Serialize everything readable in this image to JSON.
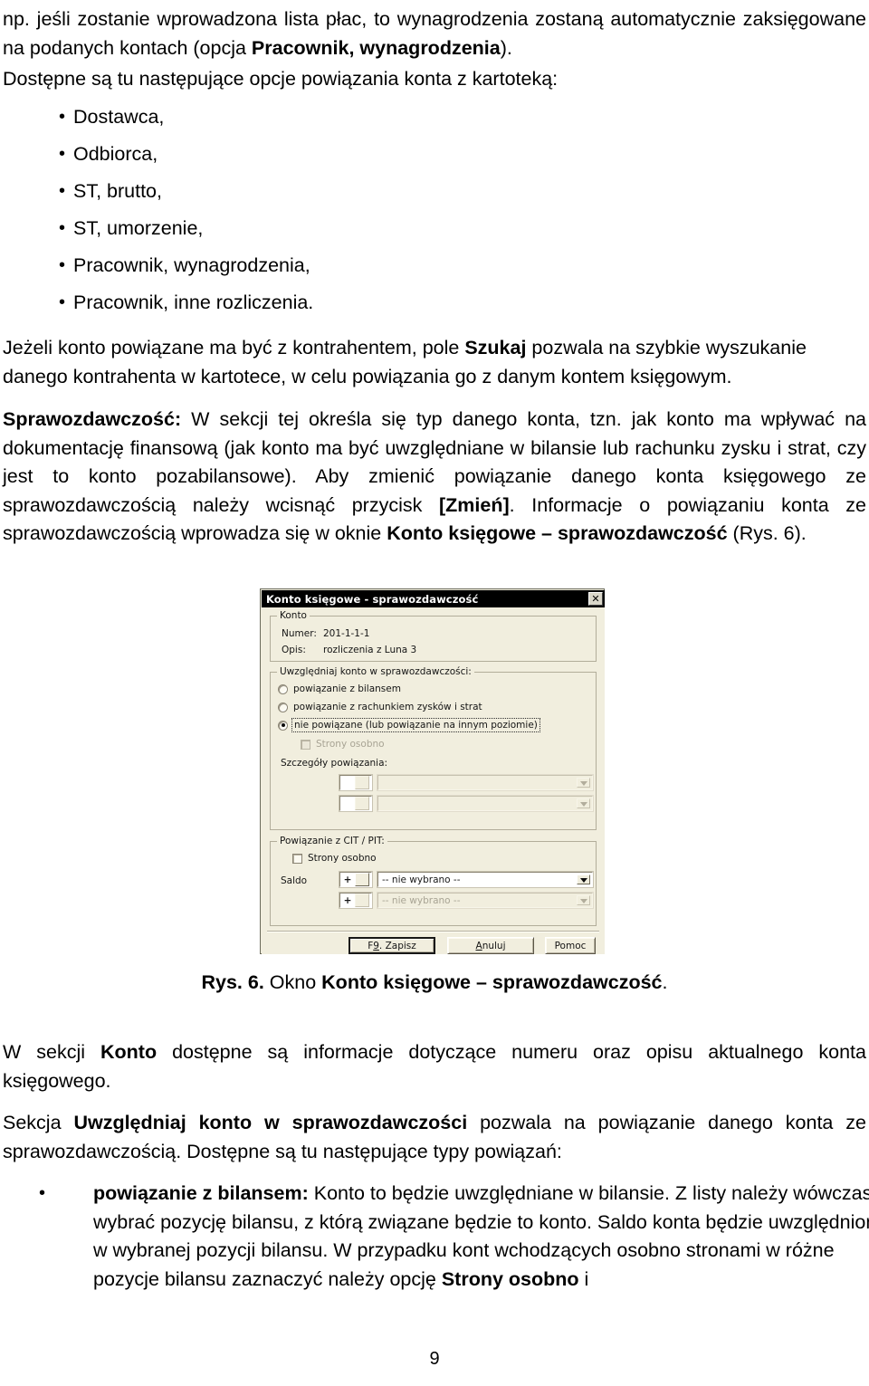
{
  "document": {
    "page_number": "9",
    "paragraphs": {
      "intro": {
        "line1_plain_a": "np. jeśli zostanie wprowadzona lista płac, to wynagrodzenia zostaną automatycznie zaksięgowane na podanych kontach (opcja ",
        "line1_bold": "Pracownik, wynagrodzenia",
        "line1_plain_b": ")."
      },
      "available_options_lead": "Dostępne są tu następujące opcje powiązania konta z kartoteką:",
      "search_info_a": "Jeżeli konto powiązane ma być z kontrahentem, pole ",
      "search_info_bold": "Szukaj",
      "search_info_b": " pozwala na szybkie wyszukanie danego kontrahenta w kartotece, w celu powiązania go z danym kontem księgowym.",
      "reporting_bold": "Sprawozdawczość:",
      "reporting_a": " W sekcji tej określa się typ danego konta, tzn. jak konto ma wpływać na dokumentację finansową (jak konto ma być uwzględniane w bilansie lub rachunku zysku i strat, czy jest to konto pozabilansowe). Aby zmienić powiązanie danego konta księgowego ze sprawozdawczością należy wcisnąć przycisk ",
      "reporting_bold2": "[Zmień]",
      "reporting_b": ". Informacje o powiązaniu konta ze sprawozdawczością wprowadza się w oknie ",
      "reporting_bold3": "Konto księgowe – sprawozdawczość",
      "reporting_c": " (Rys. 6).",
      "konto_section_a": "W sekcji ",
      "konto_section_bold": "Konto",
      "konto_section_b": " dostępne są informacje dotyczące numeru oraz opisu aktualnego konta księgowego.",
      "uwzgledniaj_a": "Sekcja ",
      "uwzgledniaj_bold": "Uwzględniaj konto w sprawozdawczości",
      "uwzgledniaj_b": " pozwala na powiązanie danego konta ze sprawozdawczością. Dostępne są tu następujące typy powiązań:"
    },
    "bullet_list": [
      "Dostawca,",
      "Odbiorca,",
      "ST, brutto,",
      "ST, umorzenie,",
      "Pracownik, wynagrodzenia,",
      "Pracownik, inne rozliczenia."
    ],
    "last_bullet": {
      "bold_lead": "powiązanie z bilansem:",
      "text_a": "  Konto to będzie uwzględniane w bilansie. Z listy należy wówczas wybrać pozycję bilansu, z którą związane będzie to konto. Saldo konta będzie uwzględnione w wybranej pozycji bilansu. W przypadku kont wchodzących osobno stronami w różne pozycje bilansu zaznaczyć należy opcję ",
      "bold_tail": "Strony osobno",
      "text_b": " i"
    },
    "figure_caption": {
      "bold_prefix": "Rys. 6.",
      "plain_mid": " Okno ",
      "bold_title": "Konto księgowe – sprawozdawczość",
      "plain_suffix": "."
    }
  },
  "dialog": {
    "title": "Konto księgowe - sprawozdawczość",
    "close_icon_label": "✕",
    "group_konto": {
      "legend": "Konto",
      "numer_label": "Numer:",
      "numer_value": "201-1-1-1",
      "opis_label": "Opis:",
      "opis_value": "rozliczenia z Luna 3"
    },
    "group_uwzgledniaj": {
      "legend": "Uwzględniaj konto w sprawozdawczości:",
      "radios": [
        {
          "label": "powiązanie z bilansem",
          "checked": false,
          "focused": false
        },
        {
          "label": "powiązanie z rachunkiem zysków i strat",
          "checked": false,
          "focused": false
        },
        {
          "label": "nie powiązane (lub powiązanie na innym poziomie)",
          "checked": true,
          "focused": true
        }
      ],
      "strony_osobno_checkbox": {
        "label": "Strony osobno",
        "checked": false,
        "disabled": true
      },
      "szczegoly_label": "Szczegóły powiązania:",
      "detail_rows": [
        {
          "sign": "",
          "value": "",
          "disabled": true
        },
        {
          "sign": "",
          "value": "",
          "disabled": true
        }
      ]
    },
    "group_cit_pit": {
      "legend": "Powiązanie z CIT / PIT:",
      "strony_osobno_checkbox": {
        "label": "Strony osobno",
        "checked": false,
        "disabled": false
      },
      "saldo_label": "Saldo",
      "rows": [
        {
          "sign": "+",
          "value": "-- nie wybrano --",
          "disabled": false
        },
        {
          "sign": "+",
          "value": "-- nie wybrano --",
          "disabled": true
        }
      ]
    },
    "buttons": [
      {
        "label_pre": "F",
        "label_accel": "9",
        "label_post": ". Zapisz",
        "name": "save-button",
        "default": true
      },
      {
        "label_pre": "",
        "label_accel": "A",
        "label_post": "nuluj",
        "name": "cancel-button",
        "default": false
      },
      {
        "label_pre": "Pomoc",
        "label_accel": "",
        "label_post": "",
        "name": "help-button",
        "default": false
      }
    ]
  },
  "colors": {
    "dialog_face": "#ece9d8",
    "titlebar": "#000000",
    "field_white": "#ffffff",
    "text": "#000000"
  }
}
